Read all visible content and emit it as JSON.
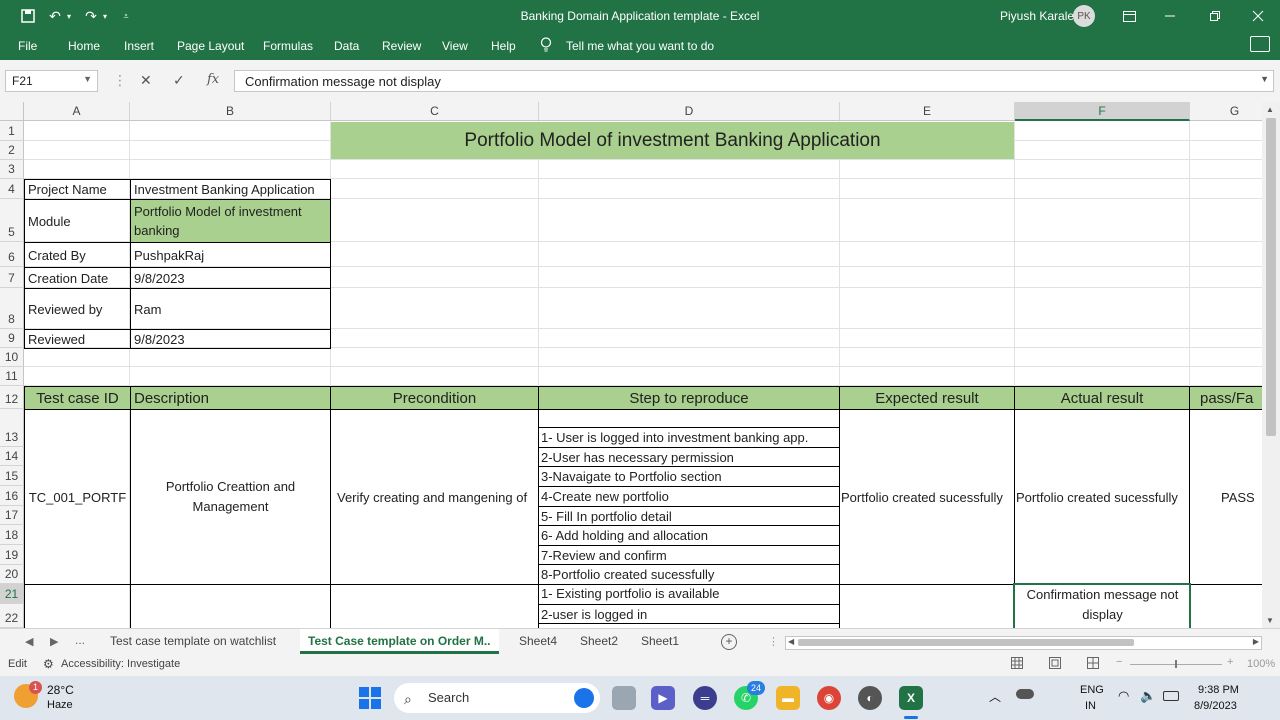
{
  "window": {
    "title": "Banking Domain Application template  -  Excel",
    "user_name": "Piyush Karale",
    "user_initials": "PK"
  },
  "menu": {
    "items": [
      "File",
      "Home",
      "Insert",
      "Page Layout",
      "Formulas",
      "Data",
      "Review",
      "View",
      "Help"
    ],
    "tell_me": "Tell me what you want to do"
  },
  "formula_bar": {
    "cell_ref": "F21",
    "fx": "fx",
    "content": "Confirmation message not display"
  },
  "columns": [
    "A",
    "B",
    "C",
    "D",
    "E",
    "F",
    "G"
  ],
  "rows": [
    "1",
    "2",
    "3",
    "4",
    "5",
    "6",
    "7",
    "8",
    "9",
    "10",
    "11",
    "12",
    "13",
    "14",
    "15",
    "16",
    "17",
    "18",
    "19",
    "20",
    "21",
    "22"
  ],
  "sheet": {
    "title": "Portfolio Model of investment Banking Application",
    "info": [
      {
        "label": "Project Name",
        "value": "Investment Banking Application"
      },
      {
        "label": "Module",
        "value": "Portfolio Model of investment banking"
      },
      {
        "label": "Crated By",
        "value": "PushpakRaj"
      },
      {
        "label": "Creation Date",
        "value": "9/8/2023"
      },
      {
        "label": "Reviewed by",
        "value": "Ram"
      },
      {
        "label": "Reviewed",
        "value": "9/8/2023"
      }
    ],
    "headers": [
      "Test case ID",
      "Description",
      "Precondition",
      "Step to reproduce",
      "Expected result",
      "Actual result",
      "pass/Fa"
    ],
    "test_case_1": {
      "id": "TC_001_PORTF",
      "description": "Portfolio  Creattion and Management",
      "precondition": "Verify creating and mangening of",
      "steps": [
        "1- User is logged into investment banking app.",
        "2-User has necessary permission",
        "3-Navaigate to Portfolio section",
        "4-Create new portfolio",
        "5- Fill In portfolio detail",
        "6- Add holding and allocation",
        "7-Review and confirm",
        "8-Portfolio created sucessfully"
      ],
      "expected": "Portfolio created sucessfully",
      "actual": "Portfolio created sucessfully",
      "status": "PASS"
    },
    "test_case_2": {
      "steps": [
        "1- Existing portfolio is available",
        "2-user is logged in"
      ],
      "actual": "Confirmation message not display"
    }
  },
  "tabs": {
    "ellipsis": "...",
    "items": [
      "Test case template on watchlist",
      "Test Case template on Order M..",
      "Sheet4",
      "Sheet2",
      "Sheet1"
    ],
    "active_index": 1
  },
  "status": {
    "mode": "Edit",
    "accessibility": "Accessibility: Investigate",
    "zoom": "100%"
  },
  "taskbar": {
    "weather_temp": "28°C",
    "weather_desc": "Haze",
    "weather_badge": "1",
    "search_label": "Search",
    "whatsapp_badge": "24",
    "lang_top": "ENG",
    "lang_bottom": "IN",
    "time": "9:38 PM",
    "date": "8/9/2023"
  },
  "colors": {
    "excel_green": "#217346",
    "cell_green": "#a9d08e"
  }
}
